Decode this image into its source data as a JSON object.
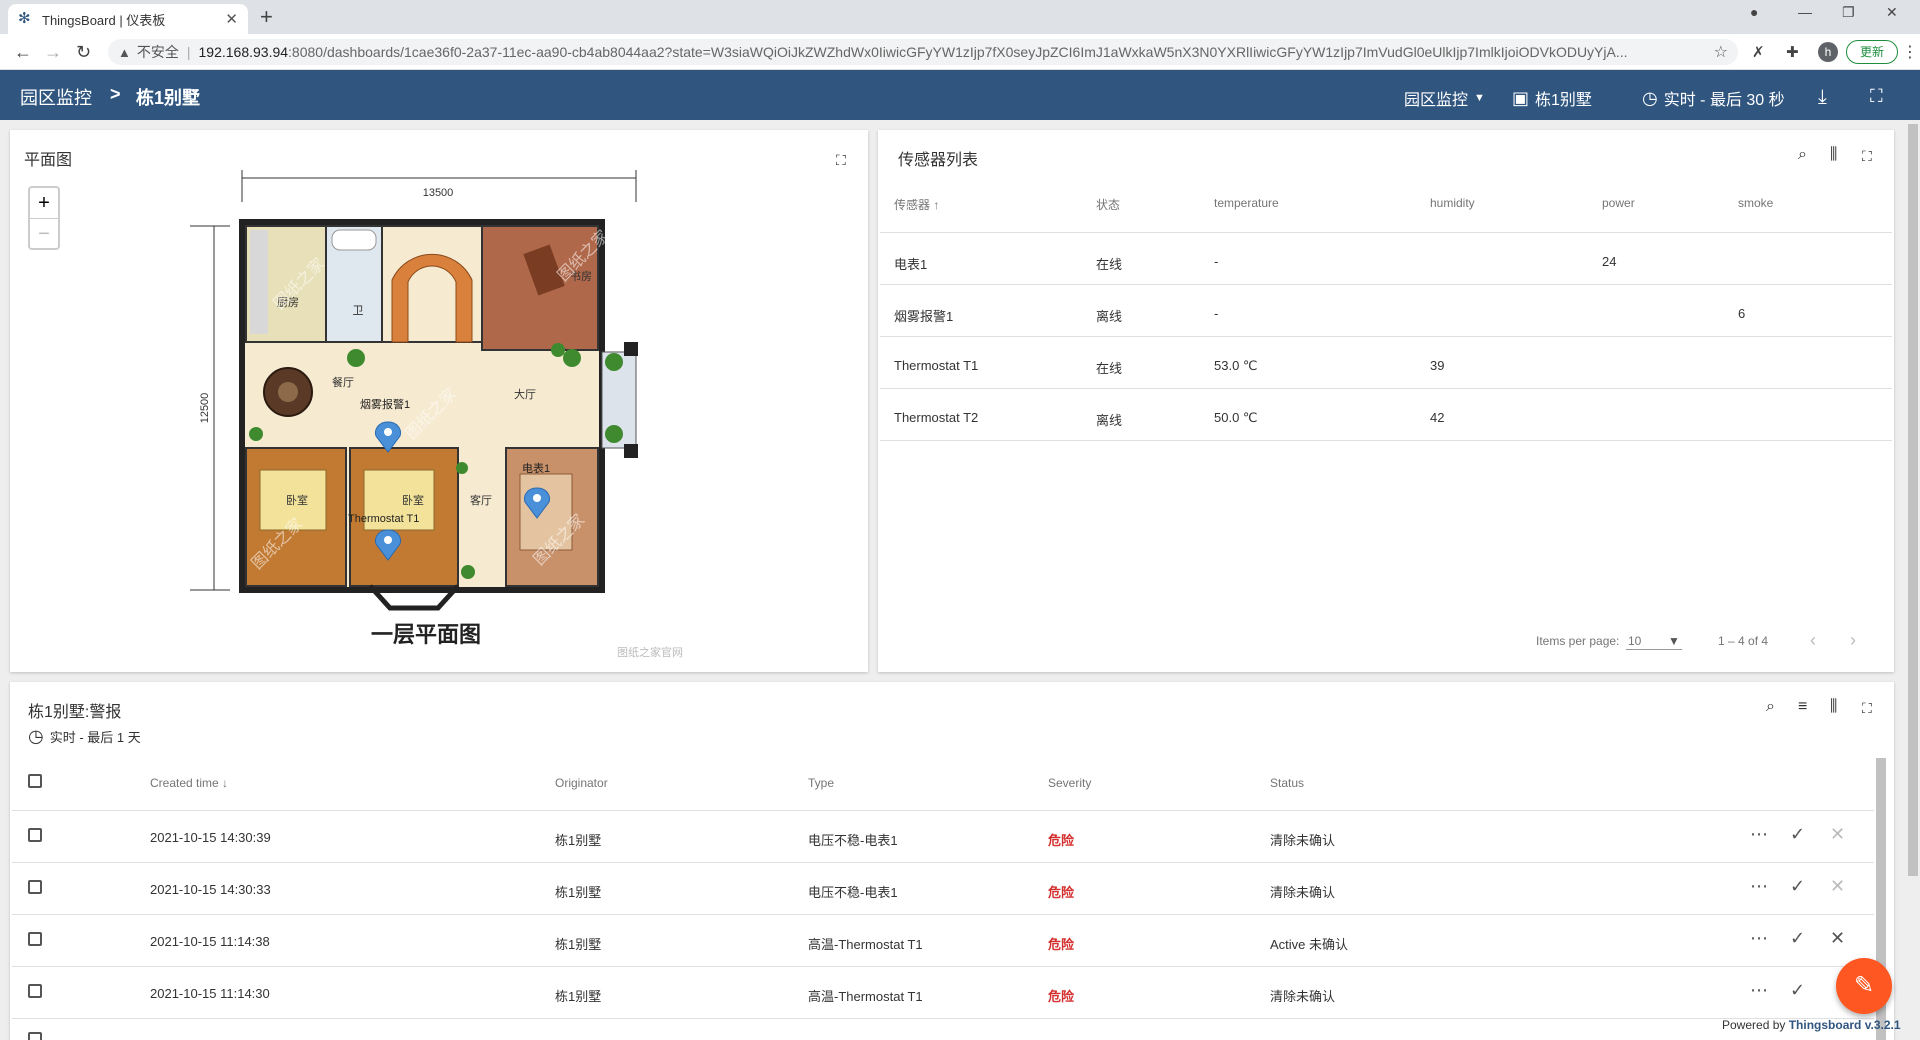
{
  "browser": {
    "tab_title": "ThingsBoard | 仪表板",
    "insecure_label": "不安全",
    "url_host": "192.168.93.94",
    "url_path": ":8080/dashboards/1cae36f0-2a37-11ec-aa90-cb4ab8044aa2?state=W3siaWQiOiJkZWZhdWx0IiwicGFyYW1zIjp7fX0seyJpZCI6ImJ1aWxkaW5nX3N0YXRlIiwicGFyYW1zIjp7ImVudGl0eUlkIjp7ImlkIjoiODVkODUyYjA...",
    "update_label": "更新",
    "profile_initial": "h"
  },
  "toolbar": {
    "breadcrumb_root": "园区监控",
    "breadcrumb_sep": ">",
    "breadcrumb_current": "栋1别墅",
    "state_select": "园区监控",
    "entity_label": "栋1别墅",
    "timewindow": "实时 - 最后 30 秒"
  },
  "floorplan": {
    "title": "平面图",
    "zoom_in": "+",
    "zoom_out": "−",
    "dim_width": "13500",
    "dim_height": "12500",
    "rooms": {
      "kitchen": "厨房",
      "bath": "卫",
      "dining": "餐厅",
      "living_big": "大厅",
      "bed1": "卧室",
      "bed2": "卧室",
      "living": "客厅",
      "study": "书房"
    },
    "markers": {
      "smoke": "烟雾报警1",
      "meter": "电表1",
      "thermo": "Thermostat T1"
    },
    "watermark": "图纸之家",
    "caption": "一层平面图",
    "source": "图纸之家官网"
  },
  "sensors": {
    "title": "传感器列表",
    "columns": [
      "传感器",
      "状态",
      "temperature",
      "humidity",
      "power",
      "smoke"
    ],
    "sort_arrow": "↑",
    "rows": [
      {
        "name": "电表1",
        "status": "在线",
        "temperature": "-",
        "humidity": "",
        "power": "24",
        "smoke": ""
      },
      {
        "name": "烟雾报警1",
        "status": "离线",
        "temperature": "-",
        "humidity": "",
        "power": "",
        "smoke": "6"
      },
      {
        "name": "Thermostat T1",
        "status": "在线",
        "temperature": "53.0 ℃",
        "humidity": "39",
        "power": "",
        "smoke": ""
      },
      {
        "name": "Thermostat T2",
        "status": "离线",
        "temperature": "50.0 ℃",
        "humidity": "42",
        "power": "",
        "smoke": ""
      }
    ],
    "pager_label": "Items per page:",
    "page_size": "10",
    "range": "1 – 4 of 4"
  },
  "alarms": {
    "title": "栋1别墅:警报",
    "timewindow": "实时 - 最后 1 天",
    "columns": [
      "Created time",
      "Originator",
      "Type",
      "Severity",
      "Status"
    ],
    "sort_arrow": "↓",
    "rows": [
      {
        "time": "2021-10-15 14:30:39",
        "originator": "栋1别墅",
        "type": "电压不稳-电表1",
        "severity": "危险",
        "status": "清除未确认"
      },
      {
        "time": "2021-10-15 14:30:33",
        "originator": "栋1别墅",
        "type": "电压不稳-电表1",
        "severity": "危险",
        "status": "清除未确认"
      },
      {
        "time": "2021-10-15 11:14:38",
        "originator": "栋1别墅",
        "type": "高温-Thermostat T1",
        "severity": "危险",
        "status": "Active 未确认"
      },
      {
        "time": "2021-10-15 11:14:30",
        "originator": "栋1别墅",
        "type": "高温-Thermostat T1",
        "severity": "危险",
        "status": "清除未确认"
      }
    ]
  },
  "footer": {
    "powered_prefix": "Powered by",
    "powered_brand": "Thingsboard v.3.2.1"
  },
  "colors": {
    "primary": "#305680",
    "danger": "#d32f2f",
    "fab": "#ff5722"
  }
}
